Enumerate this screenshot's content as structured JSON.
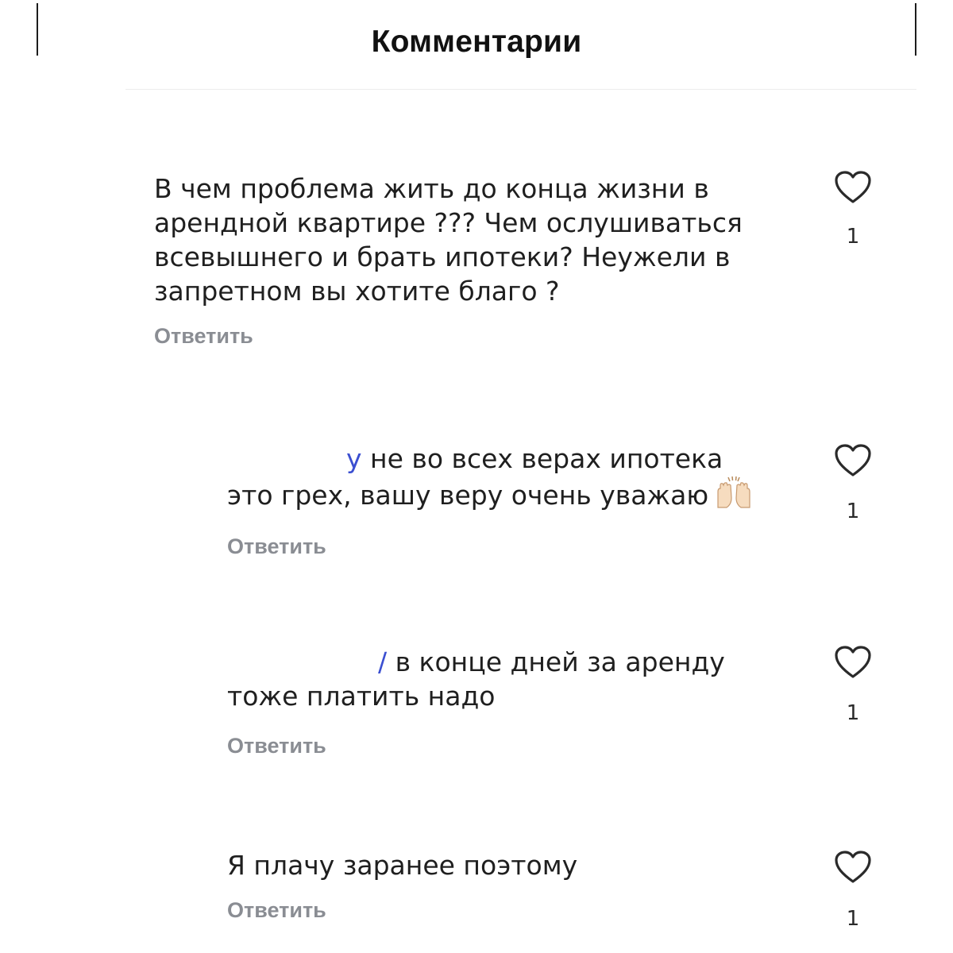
{
  "header": {
    "title": "Комментарии"
  },
  "comments": [
    {
      "text": "В чем проблема жить до конца жизни в арендной квартире ??? Чем ослушиваться всевышнего и брать ипотеки? Неужели в запретном вы хотите благо ?",
      "reply_label": "Ответить",
      "likes": "1",
      "icon": "heart-outline-icon"
    },
    {
      "mention_tail": "у",
      "text_line1": " не во всех верах ипотека",
      "text_line2": "это грех, вашу веру очень уважаю",
      "emoji": "raising-hands-icon",
      "reply_label": "Ответить",
      "likes": "1",
      "icon": "heart-outline-icon"
    },
    {
      "mention_tail": "/",
      "text_line1": " в конце дней за аренду",
      "text_line2": "тоже платить надо",
      "reply_label": "Ответить",
      "likes": "1",
      "icon": "heart-outline-icon"
    },
    {
      "text": "Я плачу заранее поэтому",
      "reply_label": "Ответить",
      "likes": "1",
      "icon": "heart-outline-icon"
    }
  ],
  "colors": {
    "text": "#1f1f1f",
    "reply": "#8a8d93",
    "mention": "#3b4fd1",
    "heart_stroke": "#2a2a2a"
  }
}
